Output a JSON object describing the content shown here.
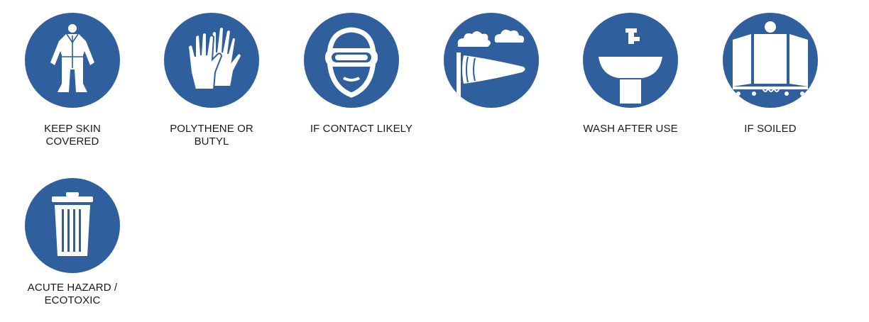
{
  "signs": [
    {
      "icon": "protective-suit-icon",
      "caption": "KEEP SKIN\nCOVERED"
    },
    {
      "icon": "gloves-icon",
      "caption": "POLYTHENE OR\nBUTYL"
    },
    {
      "icon": "goggles-icon",
      "caption": "IF CONTACT LIKELY"
    },
    {
      "icon": "windsock-icon",
      "caption": ""
    },
    {
      "icon": "wash-basin-icon",
      "caption": "WASH AFTER USE"
    },
    {
      "icon": "changing-screen-icon",
      "caption": "IF SOILED"
    },
    {
      "icon": "waste-bin-icon",
      "caption": "ACUTE HAZARD /\nECOTOXIC"
    }
  ],
  "colors": {
    "sign_blue": "#2f5f9c",
    "symbol": "#ffffff",
    "text": "#1a1a1a"
  }
}
